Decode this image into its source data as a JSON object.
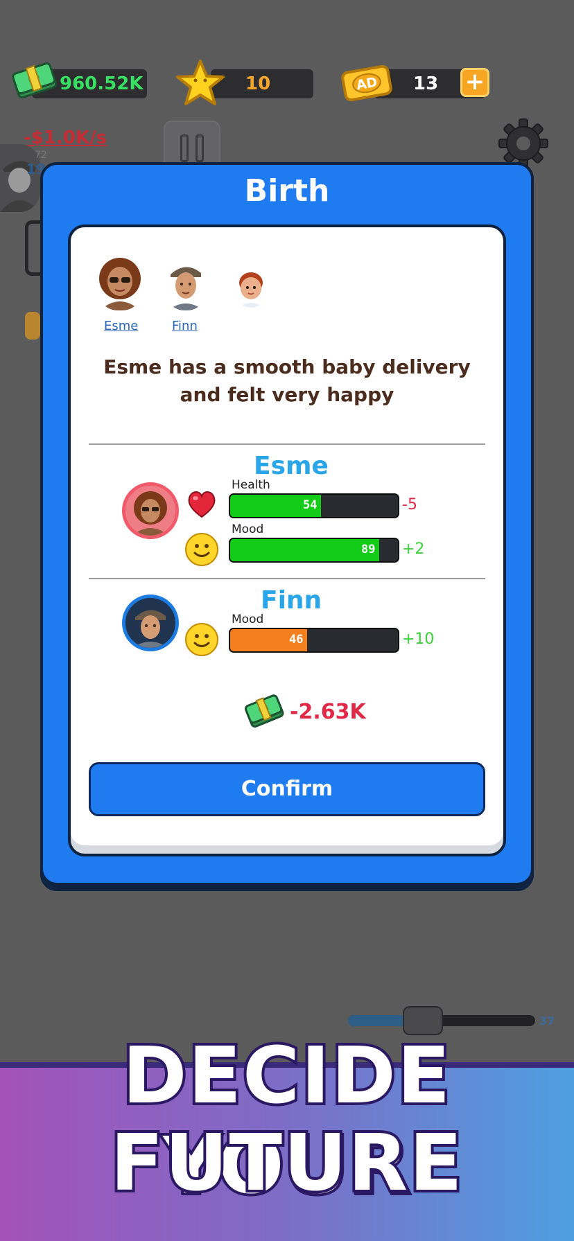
{
  "hud": {
    "cash": "960.52K",
    "stars": "10",
    "ad_icon_text": "AD",
    "tickets": "13",
    "plus": "+"
  },
  "background": {
    "income_rate": "-$1.0K/s",
    "age": "72",
    "side_number": "19",
    "slider": {
      "value": "37",
      "level": 0.4
    }
  },
  "modal": {
    "title": "Birth",
    "participants": [
      {
        "name": "Esme"
      },
      {
        "name": "Finn"
      }
    ],
    "story": "Esme has a smooth baby delivery and felt very happy",
    "people": [
      {
        "name": "Esme",
        "stats": [
          {
            "label": "Health",
            "value": 54,
            "max": 100,
            "color": "#12cc18",
            "delta": "-5",
            "delta_color": "#e02947",
            "icon": "heart-icon"
          },
          {
            "label": "Mood",
            "value": 89,
            "max": 100,
            "color": "#12cc18",
            "delta": "+2",
            "delta_color": "#3bd03b",
            "icon": "smiley-icon"
          }
        ]
      },
      {
        "name": "Finn",
        "stats": [
          {
            "label": "Mood",
            "value": 46,
            "max": 100,
            "color": "#f47f1f",
            "delta": "+10",
            "delta_color": "#3bd03b",
            "icon": "smiley-icon"
          }
        ]
      }
    ],
    "money_delta": "-2.63K",
    "confirm_label": "Confirm"
  },
  "promo": {
    "line1": "DECIDE YOUR",
    "line2": "FUTURE"
  },
  "colors": {
    "modal_blue": "#1e7cf0",
    "name_blue": "#2aa6e8",
    "bar_green": "#12cc18",
    "bar_orange": "#f47f1f",
    "negative_red": "#e02947",
    "positive_green": "#3bd03b"
  }
}
